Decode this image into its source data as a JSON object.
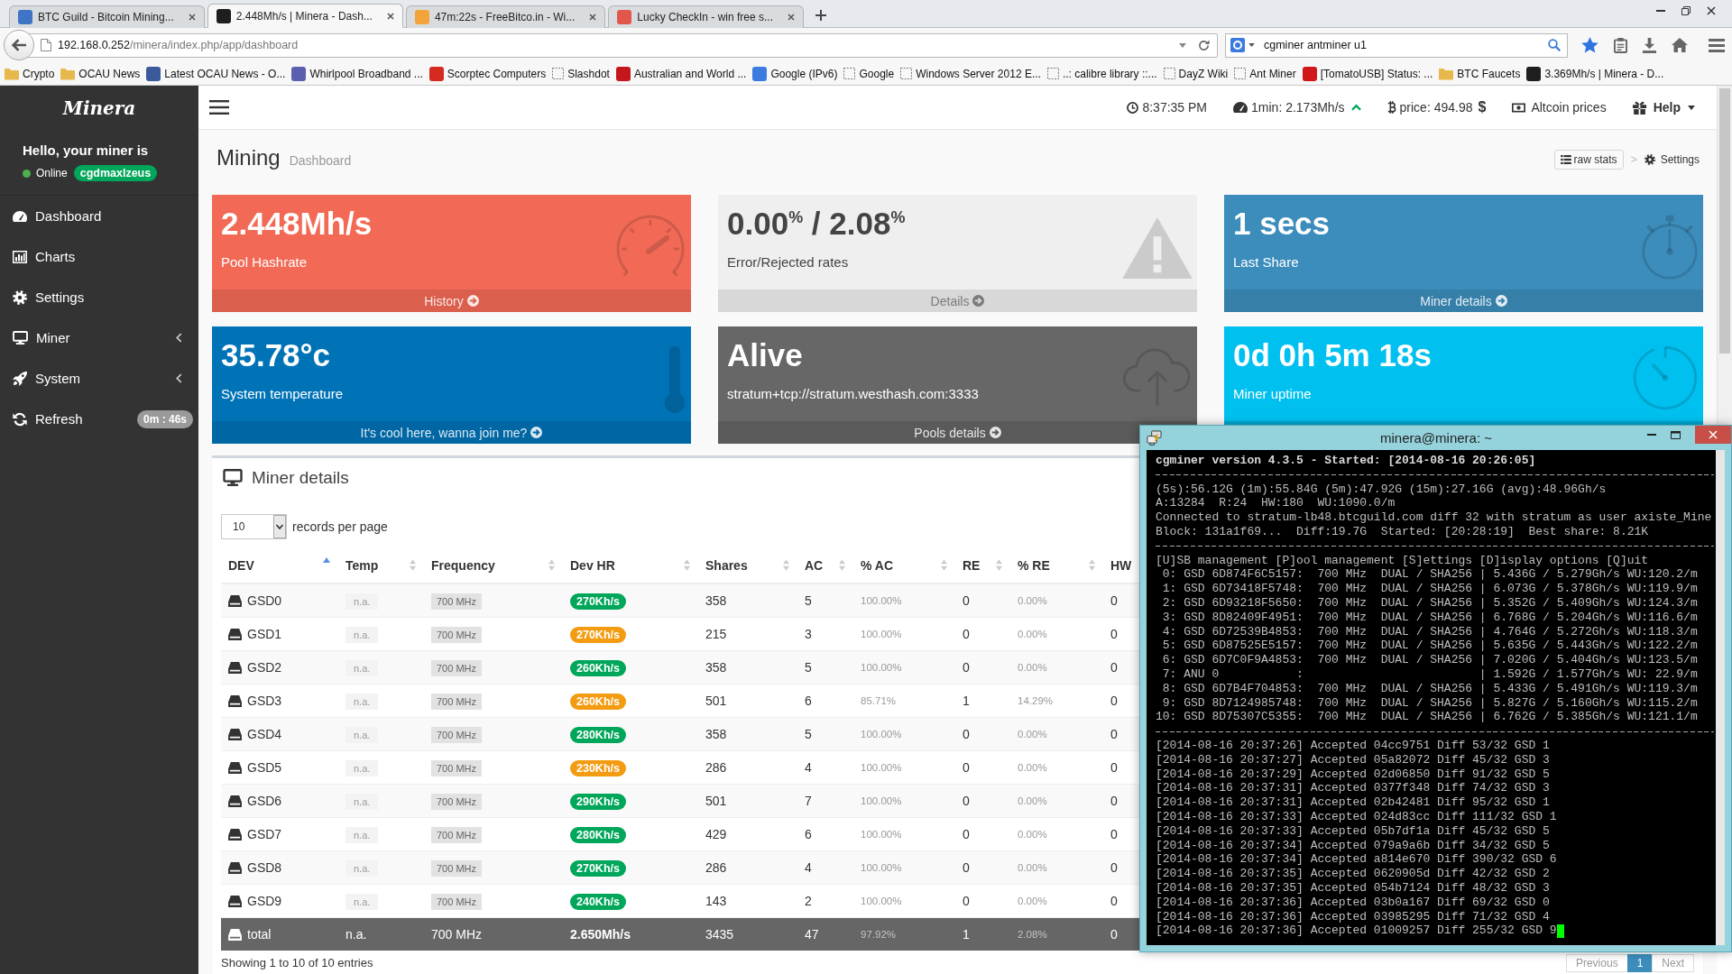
{
  "browser": {
    "tabs": [
      {
        "title": "BTC Guild - Bitcoin Mining...",
        "selected": false,
        "color": "#3f74c7"
      },
      {
        "title": "2.448Mh/s | Minera - Dash...",
        "selected": true,
        "color": "#1e1e1e"
      },
      {
        "title": "47m:22s - FreeBitco.in - Wi...",
        "selected": false,
        "color": "#f2a33a"
      },
      {
        "title": "Lucky CheckIn - win free s...",
        "selected": false,
        "color": "#e2574c"
      }
    ],
    "address": {
      "host": "192.168.0.252",
      "path": "/minera/index.php/app/dashboard"
    },
    "search": {
      "value": "cgminer antminer u1"
    },
    "bookmarks": [
      {
        "label": "Crypto",
        "kind": "folder"
      },
      {
        "label": "OCAU News",
        "kind": "folder"
      },
      {
        "label": "Latest OCAU News - O...",
        "kind": "site",
        "color": "#3a5a9c"
      },
      {
        "label": "Whirlpool Broadband ...",
        "kind": "site",
        "color": "#5b5fb0"
      },
      {
        "label": "Scorptec Computers",
        "kind": "site",
        "color": "#d42a20"
      },
      {
        "label": "Slashdot",
        "kind": "blank"
      },
      {
        "label": "Australian and World ...",
        "kind": "site",
        "color": "#c4161c"
      },
      {
        "label": "Google (IPv6)",
        "kind": "site",
        "color": "#3b7be0"
      },
      {
        "label": "Google",
        "kind": "blank"
      },
      {
        "label": "Windows Server 2012 E...",
        "kind": "blank"
      },
      {
        "label": "..: calibre library ::...",
        "kind": "blank"
      },
      {
        "label": "DayZ Wiki",
        "kind": "blank"
      },
      {
        "label": "Ant Miner",
        "kind": "blank"
      },
      {
        "label": "[TomatoUSB] Status: ...",
        "kind": "site",
        "color": "#d01818"
      },
      {
        "label": "BTC Faucets",
        "kind": "folder"
      },
      {
        "label": "3.369Mh/s | Minera - D...",
        "kind": "site",
        "color": "#1e1e1e"
      }
    ]
  },
  "sidebar": {
    "logo": "Minera",
    "greeting": "Hello, your miner is",
    "online": true,
    "status": "Online",
    "miner_name": "cgdmaxlzeus",
    "menu": [
      {
        "label": "Dashboard",
        "selected": false
      },
      {
        "label": "Charts",
        "selected": false
      },
      {
        "label": "Settings",
        "selected": false
      },
      {
        "label": "Miner",
        "selected": false,
        "expanded": false
      },
      {
        "label": "System",
        "selected": false,
        "expanded": false
      },
      {
        "label": "Refresh",
        "selected": false,
        "badge": "0m : 46s"
      }
    ]
  },
  "topbar": {
    "time": "8:37:35 PM",
    "hashrate": "1min: 2.173Mh/s",
    "rising": true,
    "price": "price: 494.98",
    "price_unit": "$",
    "altcoin": "Altcoin prices",
    "help": "Help"
  },
  "page_header": {
    "title": "Mining",
    "subtitle": "Dashboard",
    "raw_stats": "raw stats",
    "separator": ">",
    "settings": "Settings"
  },
  "cards": [
    {
      "kind": "hashrate",
      "value": "2.448Mh/s",
      "label": "Pool Hashrate",
      "link": "History"
    },
    {
      "kind": "errors",
      "value": "0.00$^{%}$ / 2.08$^{%}$",
      "label": "Error/Rejected rates",
      "link": "Details"
    },
    {
      "kind": "last_share",
      "value": "1 secs",
      "label": "Last Share",
      "link": "Miner details"
    },
    {
      "kind": "temperature",
      "value": "35.78°c",
      "label": "System temperature",
      "link": "It's cool here, wanna join me?"
    },
    {
      "kind": "pool",
      "value": "Alive",
      "label": "stratum+tcp://stratum.westhash.com:3333",
      "link": "Pools details"
    },
    {
      "kind": "uptime",
      "value": "0d 0h 5m 18s",
      "label": "Miner uptime"
    }
  ],
  "miner_details": {
    "title": "Miner details",
    "page_size": "10",
    "page_size_label": "records per page",
    "table": {
      "columns": [
        {
          "label": "DEV",
          "sorted": true
        },
        {
          "label": "Temp",
          "sorted": false
        },
        {
          "label": "Frequency",
          "sorted": false
        },
        {
          "label": "Dev HR",
          "sorted": false
        },
        {
          "label": "Shares",
          "sorted": false
        },
        {
          "label": "AC",
          "sorted": false
        },
        {
          "label": "% AC",
          "sorted": false
        },
        {
          "label": "RE",
          "sorted": false
        },
        {
          "label": "% RE",
          "sorted": false
        },
        {
          "label": "HW"
        }
      ],
      "rows": [
        {
          "dev": "GSD0",
          "temp": "n.a.",
          "frequency": "700 MHz",
          "hashrate": "270Kh/s",
          "color": "#00a65a",
          "shares": "358",
          "ac": "5",
          "ac_pct": "100.00%",
          "re": "0",
          "re_pct": "0.00%",
          "hw": "0"
        },
        {
          "dev": "GSD1",
          "temp": "n.a.",
          "frequency": "700 MHz",
          "hashrate": "270Kh/s",
          "color": "#f39c12",
          "shares": "215",
          "ac": "3",
          "ac_pct": "100.00%",
          "re": "0",
          "re_pct": "0.00%",
          "hw": "0"
        },
        {
          "dev": "GSD2",
          "temp": "n.a.",
          "frequency": "700 MHz",
          "hashrate": "260Kh/s",
          "color": "#00a65a",
          "shares": "358",
          "ac": "5",
          "ac_pct": "100.00%",
          "re": "0",
          "re_pct": "0.00%",
          "hw": "0"
        },
        {
          "dev": "GSD3",
          "temp": "n.a.",
          "frequency": "700 MHz",
          "hashrate": "260Kh/s",
          "color": "#f39c12",
          "shares": "501",
          "ac": "6",
          "ac_pct": "85.71%",
          "re": "1",
          "re_pct": "14.29%",
          "hw": "0"
        },
        {
          "dev": "GSD4",
          "temp": "n.a.",
          "frequency": "700 MHz",
          "hashrate": "280Kh/s",
          "color": "#00a65a",
          "shares": "358",
          "ac": "5",
          "ac_pct": "100.00%",
          "re": "0",
          "re_pct": "0.00%",
          "hw": "0"
        },
        {
          "dev": "GSD5",
          "temp": "n.a.",
          "frequency": "700 MHz",
          "hashrate": "230Kh/s",
          "color": "#f39c12",
          "shares": "286",
          "ac": "4",
          "ac_pct": "100.00%",
          "re": "0",
          "re_pct": "0.00%",
          "hw": "0"
        },
        {
          "dev": "GSD6",
          "temp": "n.a.",
          "frequency": "700 MHz",
          "hashrate": "290Kh/s",
          "color": "#00a65a",
          "shares": "501",
          "ac": "7",
          "ac_pct": "100.00%",
          "re": "0",
          "re_pct": "0.00%",
          "hw": "0"
        },
        {
          "dev": "GSD7",
          "temp": "n.a.",
          "frequency": "700 MHz",
          "hashrate": "280Kh/s",
          "color": "#00a65a",
          "shares": "429",
          "ac": "6",
          "ac_pct": "100.00%",
          "re": "0",
          "re_pct": "0.00%",
          "hw": "0"
        },
        {
          "dev": "GSD8",
          "temp": "n.a.",
          "frequency": "700 MHz",
          "hashrate": "270Kh/s",
          "color": "#00a65a",
          "shares": "286",
          "ac": "4",
          "ac_pct": "100.00%",
          "re": "0",
          "re_pct": "0.00%",
          "hw": "0"
        },
        {
          "dev": "GSD9",
          "temp": "n.a.",
          "frequency": "700 MHz",
          "hashrate": "240Kh/s",
          "color": "#00a65a",
          "shares": "143",
          "ac": "2",
          "ac_pct": "100.00%",
          "re": "0",
          "re_pct": "0.00%",
          "hw": "0"
        }
      ],
      "total": {
        "dev": "total",
        "temp": "n.a.",
        "frequency": "700 MHz",
        "hashrate": "2.650Mh/s",
        "shares": "3435",
        "ac": "47",
        "ac_pct": "97.92%",
        "re": "1",
        "re_pct": "2.08%",
        "hw": "0"
      }
    },
    "info": "Showing 1 to 10 of 10 entries",
    "pagination": [
      {
        "label": "Previous",
        "selected": false,
        "disabled": true
      },
      {
        "label": "1",
        "selected": true,
        "disabled": false
      },
      {
        "label": "Next",
        "selected": false,
        "disabled": true
      }
    ]
  },
  "terminal": {
    "title": "minera@minera: ~",
    "cursor": true,
    "lines": [
      {
        "kind": "heading",
        "text": "cgminer version 4.3.5 - Started: [2014-08-16 20:26:05]"
      },
      {
        "kind": "rule"
      },
      {
        "kind": "text",
        "text": "(5s):56.12G (1m):55.84G (5m):47.92G (15m):27.16G (avg):48.96Gh/s"
      },
      {
        "kind": "text",
        "text": "A:13284  R:24  HW:180  WU:1090.0/m"
      },
      {
        "kind": "text",
        "text": "Connected to stratum-lb48.btcguild.com diff 32 with stratum as user axiste_Mine"
      },
      {
        "kind": "text",
        "text": "Block: 131a1f69...  Diff:19.7G  Started: [20:28:19]  Best share: 8.21K"
      },
      {
        "kind": "rule"
      },
      {
        "kind": "text",
        "text": "[U]SB management [P]ool management [S]ettings [D]isplay options [Q]uit"
      },
      {
        "kind": "text",
        "text": " 0: GSD 6D874F6C5157:  700 MHz  DUAL / SHA256 | 5.436G / 5.279Gh/s WU:120.2/m"
      },
      {
        "kind": "text",
        "text": " 1: GSD 6D73418F5748:  700 MHz  DUAL / SHA256 | 6.073G / 5.378Gh/s WU:119.9/m"
      },
      {
        "kind": "text",
        "text": " 2: GSD 6D93218F5650:  700 MHz  DUAL / SHA256 | 5.352G / 5.409Gh/s WU:124.3/m"
      },
      {
        "kind": "text",
        "text": " 3: GSD 8D82409F4951:  700 MHz  DUAL / SHA256 | 6.768G / 5.204Gh/s WU:116.6/m"
      },
      {
        "kind": "text",
        "text": " 4: GSD 6D72539B4853:  700 MHz  DUAL / SHA256 | 4.764G / 5.272Gh/s WU:118.3/m"
      },
      {
        "kind": "text",
        "text": " 5: GSD 6D87525E5157:  700 MHz  DUAL / SHA256 | 5.635G / 5.443Gh/s WU:122.2/m"
      },
      {
        "kind": "text",
        "text": " 6: GSD 6D7C0F9A4853:  700 MHz  DUAL / SHA256 | 7.020G / 5.404Gh/s WU:123.5/m"
      },
      {
        "kind": "text",
        "text": " 7: ANU 0           :                         | 1.592G / 1.577Gh/s WU: 22.9/m"
      },
      {
        "kind": "text",
        "text": " 8: GSD 6D7B4F704853:  700 MHz  DUAL / SHA256 | 5.433G / 5.491Gh/s WU:119.3/m"
      },
      {
        "kind": "text",
        "text": " 9: GSD 8D7124985748:  700 MHz  DUAL / SHA256 | 5.827G / 5.160Gh/s WU:115.2/m"
      },
      {
        "kind": "text",
        "text": "10: GSD 8D75307C5355:  700 MHz  DUAL / SHA256 | 6.762G / 5.385Gh/s WU:121.1/m"
      },
      {
        "kind": "rule"
      },
      {
        "kind": "text",
        "text": "[2014-08-16 20:37:26] Accepted 04cc9751 Diff 53/32 GSD 1"
      },
      {
        "kind": "text",
        "text": "[2014-08-16 20:37:27] Accepted 05a82072 Diff 45/32 GSD 3"
      },
      {
        "kind": "text",
        "text": "[2014-08-16 20:37:29] Accepted 02d06850 Diff 91/32 GSD 5"
      },
      {
        "kind": "text",
        "text": "[2014-08-16 20:37:31] Accepted 0377f348 Diff 74/32 GSD 3"
      },
      {
        "kind": "text",
        "text": "[2014-08-16 20:37:31] Accepted 02b42481 Diff 95/32 GSD 1"
      },
      {
        "kind": "text",
        "text": "[2014-08-16 20:37:33] Accepted 024d83cc Diff 111/32 GSD 1"
      },
      {
        "kind": "text",
        "text": "[2014-08-16 20:37:33] Accepted 05b7df1a Diff 45/32 GSD 5"
      },
      {
        "kind": "text",
        "text": "[2014-08-16 20:37:34] Accepted 079a9a6b Diff 34/32 GSD 5"
      },
      {
        "kind": "text",
        "text": "[2014-08-16 20:37:34] Accepted a814e670 Diff 390/32 GSD 6"
      },
      {
        "kind": "text",
        "text": "[2014-08-16 20:37:35] Accepted 0620905d Diff 42/32 GSD 2"
      },
      {
        "kind": "text",
        "text": "[2014-08-16 20:37:35] Accepted 054b7124 Diff 48/32 GSD 3"
      },
      {
        "kind": "text",
        "text": "[2014-08-16 20:37:36] Accepted 03b0a167 Diff 69/32 GSD 0"
      },
      {
        "kind": "text",
        "text": "[2014-08-16 20:37:36] Accepted 03985295 Diff 71/32 GSD 4"
      },
      {
        "kind": "text",
        "text": "[2014-08-16 20:37:36] Accepted 01009257 Diff 255/32 GSD 9"
      }
    ]
  }
}
